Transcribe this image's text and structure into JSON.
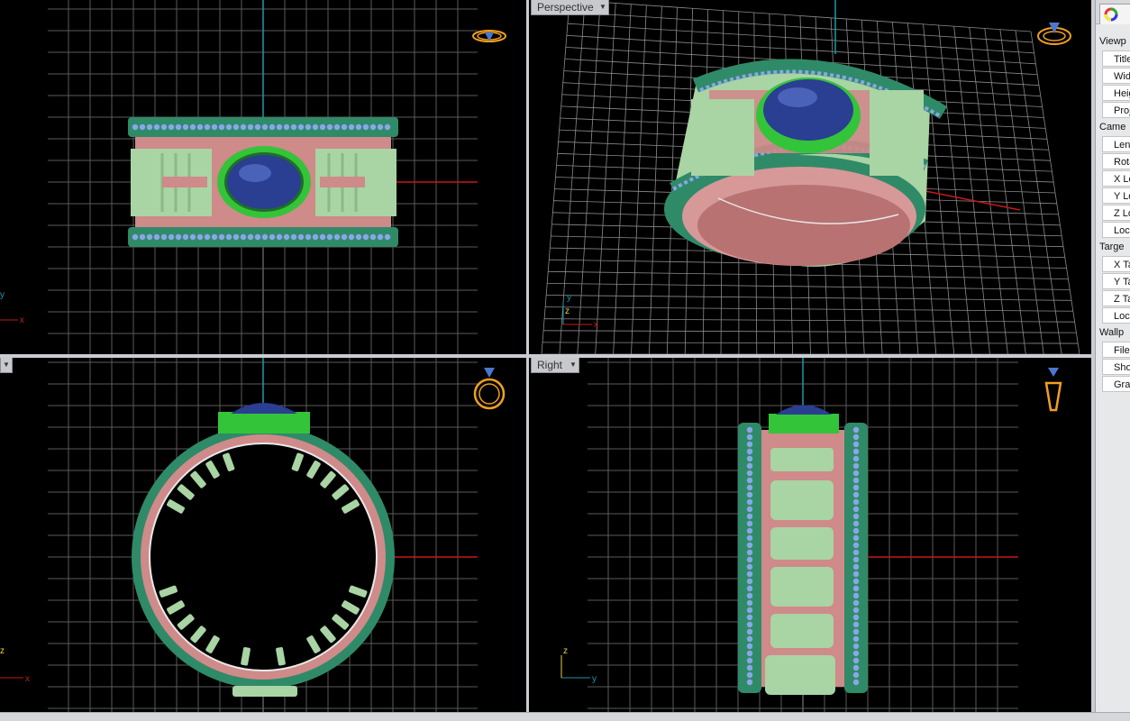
{
  "viewports": {
    "top": {
      "label": ""
    },
    "perspective": {
      "label": "Perspective"
    },
    "front": {
      "label": ""
    },
    "right": {
      "label": "Right"
    }
  },
  "axes": {
    "top": {
      "h": "x",
      "v": "y"
    },
    "perspective": {
      "a": "x",
      "b": "y",
      "c": "z"
    },
    "front": {
      "h": "x",
      "v": "z"
    },
    "right": {
      "h": "y",
      "v": "z"
    }
  },
  "panel": {
    "icon": "color-wheel-icon",
    "rows": [
      {
        "text": "Viewp",
        "kind": "sec"
      },
      {
        "text": "Title",
        "kind": "prop"
      },
      {
        "text": "Wid",
        "kind": "prop"
      },
      {
        "text": "Heig",
        "kind": "prop"
      },
      {
        "text": "Proj",
        "kind": "prop"
      },
      {
        "text": "Came",
        "kind": "sec"
      },
      {
        "text": "Len",
        "kind": "prop"
      },
      {
        "text": "Rota",
        "kind": "prop"
      },
      {
        "text": "X Lo",
        "kind": "prop"
      },
      {
        "text": "Y Lo",
        "kind": "prop"
      },
      {
        "text": "Z Lo",
        "kind": "prop"
      },
      {
        "text": "Loc",
        "kind": "prop"
      },
      {
        "text": "Targe",
        "kind": "sec"
      },
      {
        "text": "X Ta",
        "kind": "prop"
      },
      {
        "text": "Y Ta",
        "kind": "prop"
      },
      {
        "text": "Z Ta",
        "kind": "prop"
      },
      {
        "text": "Loc",
        "kind": "prop"
      },
      {
        "text": "Wallp",
        "kind": "sec"
      },
      {
        "text": "Filen",
        "kind": "prop"
      },
      {
        "text": "Sho",
        "kind": "prop"
      },
      {
        "text": "Gray",
        "kind": "prop"
      }
    ]
  },
  "colors": {
    "background": "#000000",
    "grid": "#5a5a5a",
    "grid_major": "#8c8c8c",
    "axis_x": "#c81818",
    "axis_y": "#1a9aa8",
    "metal_pink": "#cf8a8a",
    "band_green": "#2f8a68",
    "letter_green": "#a9d4a3",
    "bezel_green": "#33c43a",
    "stone_blue": "#2a3e92",
    "diamond_blue": "#8aa6e8",
    "nav_orange": "#f0a020"
  }
}
